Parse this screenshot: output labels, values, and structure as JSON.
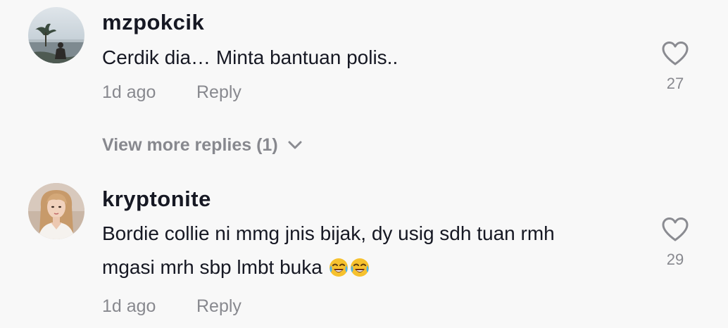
{
  "comments": [
    {
      "username": "mzpokcik",
      "text": "Cerdik dia… Minta bantuan polis..",
      "time": "1d ago",
      "reply_label": "Reply",
      "like_count": "27",
      "view_more_label": "View more replies (1)",
      "avatar_icon": "landscape-avatar"
    },
    {
      "username": "kryptonite",
      "text_line1": "Bordie collie ni mmg jnis bijak, dy usig sdh tuan rmh",
      "text_line2": "mgasi mrh sbp lmbt buka ",
      "emojis": [
        "face-with-tears-of-joy-icon",
        "face-with-tears-of-joy-icon"
      ],
      "time": "1d ago",
      "reply_label": "Reply",
      "like_count": "29",
      "avatar_icon": "woman-avatar"
    }
  ],
  "colors": {
    "background": "#f8f8f8",
    "text_primary": "#161823",
    "text_secondary": "#8a8b91"
  }
}
